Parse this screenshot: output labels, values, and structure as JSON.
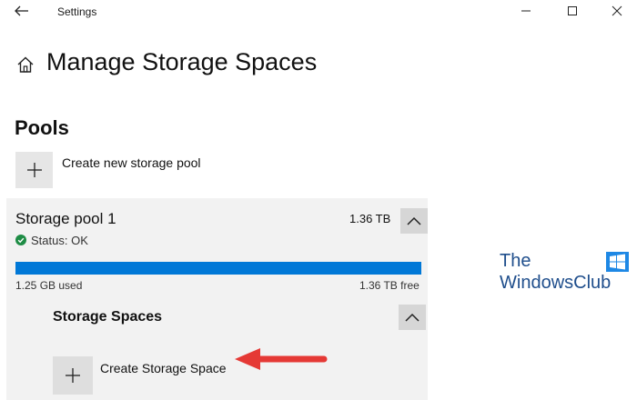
{
  "window": {
    "title": "Settings"
  },
  "page": {
    "title": "Manage Storage Spaces"
  },
  "pools": {
    "heading": "Pools",
    "create_label": "Create new storage pool",
    "items": [
      {
        "name": "Storage pool 1",
        "size": "1.36 TB",
        "status": "Status: OK",
        "used_fraction": 1.0,
        "used_text": "1.25 GB used",
        "free_text": "1.36 TB free",
        "spaces_heading": "Storage Spaces",
        "create_space_label": "Create Storage Space"
      }
    ]
  },
  "watermark": {
    "line1": "The",
    "line2": "WindowsClub"
  },
  "icons": {
    "back": "back-arrow-icon",
    "minimize": "minimize-icon",
    "maximize": "maximize-icon",
    "close": "close-icon",
    "home": "home-icon",
    "add": "plus-icon",
    "expand": "chevron-up-icon",
    "status": "check-circle-icon"
  },
  "colors": {
    "accent": "#0078d7",
    "status_ok": "#1e8c45",
    "panel": "#f2f2f2",
    "annotation_arrow": "#e53935",
    "watermark_text": "#1f4e8c"
  }
}
